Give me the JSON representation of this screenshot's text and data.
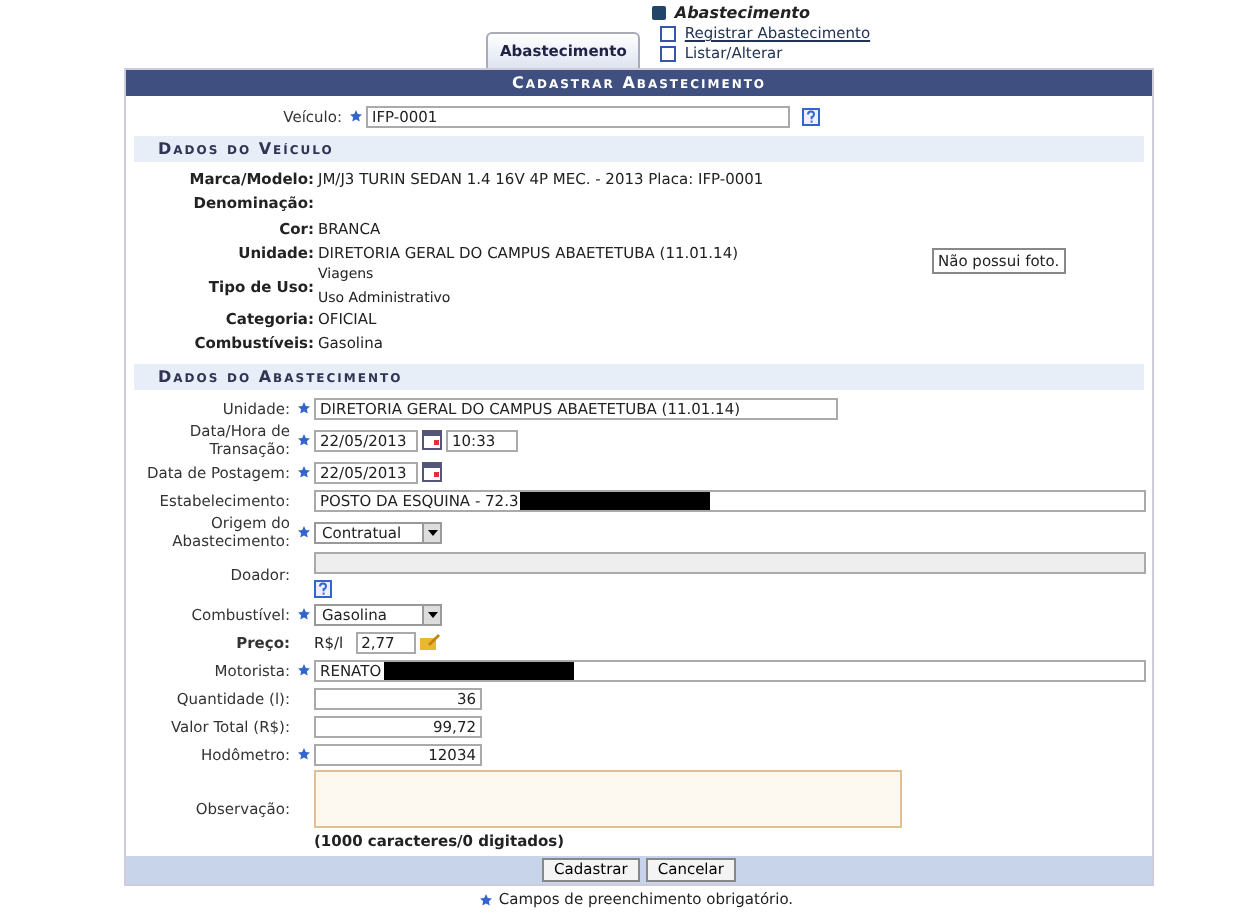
{
  "tabs": [
    {
      "label": "Abastecimento",
      "selected": true
    }
  ],
  "menu": {
    "title": "Abastecimento",
    "links": [
      {
        "label": "Registrar Abastecimento",
        "hovered": true
      },
      {
        "label": "Listar/Alterar",
        "hovered": false
      }
    ]
  },
  "form": {
    "title": "Cadastrar Abastecimento",
    "vehicle_field": {
      "label": "Veículo:",
      "required": true,
      "value": "IFP-0001"
    },
    "vehicle_section": {
      "title": "Dados do Veículo",
      "photo": "Não possui foto.",
      "rows": [
        {
          "label": "Marca/Modelo:",
          "values": [
            "JM/J3 TURIN SEDAN 1.4 16V 4P MEC. - 2013 Placa: IFP-0001"
          ]
        },
        {
          "label": "Denominação:",
          "values": []
        },
        {
          "label": "Cor:",
          "values": [
            "BRANCA"
          ]
        },
        {
          "label": "Unidade:",
          "values": [
            "DIRETORIA GERAL DO CAMPUS ABAETETUBA (11.01.14)"
          ]
        },
        {
          "label": "Tipo de Uso:",
          "values": [
            "Viagens",
            "Uso Administrativo"
          ]
        },
        {
          "label": "Categoria:",
          "values": [
            "OFICIAL"
          ]
        },
        {
          "label": "Combustíveis:",
          "values": [
            "Gasolina"
          ]
        }
      ]
    },
    "supply_section": {
      "title": "Dados do Abastecimento",
      "fields": [
        {
          "kind": "text",
          "label": "Unidade:",
          "required": true,
          "value": "DIRETORIA GERAL DO CAMPUS ABAETETUBA (11.01.14)"
        },
        {
          "kind": "datetime",
          "label": "Data/Hora de Transação:",
          "required": true,
          "value": "22/05/2013",
          "time": "10:33"
        },
        {
          "kind": "date",
          "label": "Data de Postagem:",
          "required": true,
          "value": "22/05/2013"
        },
        {
          "kind": "longtext",
          "label": "Estabelecimento:",
          "required": false,
          "value": "POSTO DA ESQUINA - 72.3",
          "redacted": true
        },
        {
          "kind": "select",
          "label": "Origem do Abastecimento:",
          "required": true,
          "value": "Contratual"
        },
        {
          "kind": "lookup",
          "label": "Doador:",
          "required": false
        },
        {
          "kind": "select",
          "label": "Combustível:",
          "required": true,
          "value": "Gasolina"
        },
        {
          "kind": "price",
          "label": "Preço:",
          "required": false,
          "unit": "R$/l",
          "value": "2,77"
        },
        {
          "kind": "longtext",
          "label": "Motorista:",
          "required": true,
          "value": "RENATO",
          "redacted": true
        },
        {
          "kind": "number",
          "label": "Quantidade (l):",
          "required": false,
          "value": "36"
        },
        {
          "kind": "number",
          "label": "Valor Total (R$):",
          "required": false,
          "value": "99,72"
        },
        {
          "kind": "number",
          "label": "Hodômetro:",
          "required": true,
          "value": "12034"
        },
        {
          "kind": "textarea",
          "label": "Observação:",
          "required": false,
          "counter": "(1000 caracteres/0 digitados)"
        }
      ]
    },
    "buttons": [
      "Cadastrar",
      "Cancelar"
    ],
    "footnote": "Campos de preenchimento obrigatório."
  }
}
